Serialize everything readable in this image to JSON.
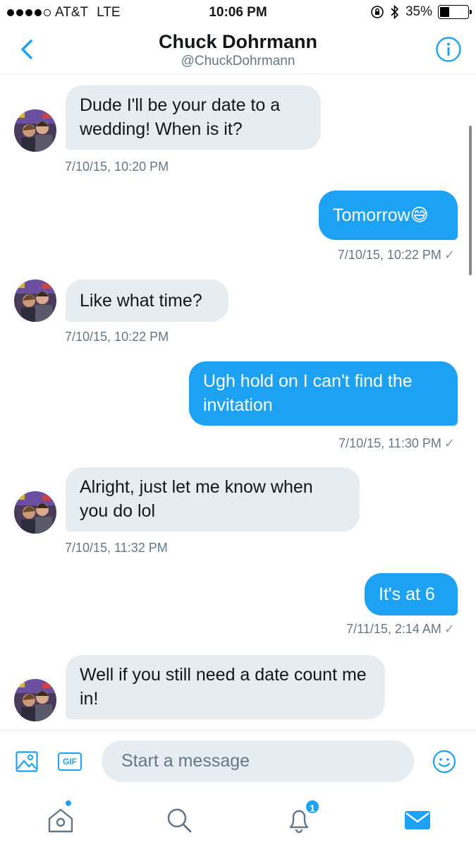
{
  "status_bar": {
    "carrier": "AT&T",
    "network": "LTE",
    "time": "10:06 PM",
    "battery": "35%",
    "battery_level": 0.35
  },
  "header": {
    "name": "Chuck Dohrmann",
    "handle": "@ChuckDohrmann",
    "back_icon": "chevron-left-icon",
    "info_icon": "info-icon"
  },
  "messages": [
    {
      "direction": "in",
      "text": "Dude I'll be your date to a wedding! When is it?",
      "timestamp": "7/10/15, 10:20 PM"
    },
    {
      "direction": "out",
      "text": "Tomorrow😅",
      "timestamp": "7/10/15, 10:22 PM",
      "check": "✓"
    },
    {
      "direction": "in",
      "text": "Like what time?",
      "timestamp": "7/10/15, 10:22 PM"
    },
    {
      "direction": "out",
      "text": "Ugh hold on I can't find the invitation",
      "timestamp": "7/10/15, 11:30 PM",
      "check": "✓"
    },
    {
      "direction": "in",
      "text": "Alright, just let me know when you do lol",
      "timestamp": "7/10/15, 11:32 PM"
    },
    {
      "direction": "out",
      "text": "It's at 6",
      "timestamp": "7/11/15, 2:14 AM",
      "check": "✓"
    },
    {
      "direction": "in",
      "text": "Well if you still need a date count me in!",
      "timestamp": ""
    }
  ],
  "composer": {
    "placeholder": "Start a message",
    "gif_label": "GIF",
    "photo_icon": "image-icon",
    "emoji_icon": "emoji-icon"
  },
  "tabbar": {
    "tabs": [
      "home",
      "search",
      "notifications",
      "messages"
    ],
    "notifications_badge": "1",
    "active_tab": "messages",
    "accent": "#1da1f2"
  },
  "colors": {
    "accent": "#1da1f2",
    "incoming_bubble": "#e6ecf0",
    "text_secondary": "#657786"
  }
}
